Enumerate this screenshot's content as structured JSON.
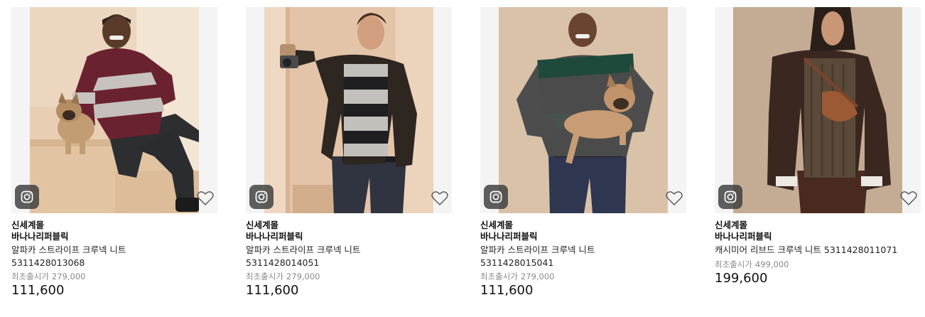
{
  "colors": {
    "tile_bg": "#f4f4f4",
    "badge_bg": "#3c3c3c",
    "muted_text": "#8a8a8a"
  },
  "icons": {
    "badge": "instagram-icon",
    "wish": "heart-outline-icon"
  },
  "products": [
    {
      "mall": "신세계몰",
      "brand": "바나나리퍼블릭",
      "name": "알파카 스트라이프 크루넥 니트",
      "code": "5311428013068",
      "original_label": "최초출시가",
      "original_price": "279,000",
      "price": "111,600",
      "image": "Man in burgundy and grey striped sweater sitting on stone steps with a french bulldog"
    },
    {
      "mall": "신세계몰",
      "brand": "바나나리퍼블릭",
      "name": "알파카 스트라이프 크루넥 니트",
      "code": "5311428014051",
      "original_label": "최초출시가",
      "original_price": "279,000",
      "price": "111,600",
      "image": "Man in leather jacket over black and grey striped sweater holding a camera"
    },
    {
      "mall": "신세계몰",
      "brand": "바나나리퍼블릭",
      "name": "알파카 스트라이프 크루넥 니트",
      "code": "5311428015041",
      "original_label": "최초출시가",
      "original_price": "279,000",
      "price": "111,600",
      "image": "Man in green and grey striped sweater holding a french bulldog"
    },
    {
      "mall": "신세계몰",
      "brand": "바나나리퍼블릭",
      "name": "캐시미어 리브드 크루넥 니트 5311428011071",
      "code": "",
      "original_label": "최초출시가",
      "original_price": "499,000",
      "price": "199,600",
      "image": "Long haired man in brown suede jacket and ribbed knit with cross-body bag"
    }
  ]
}
